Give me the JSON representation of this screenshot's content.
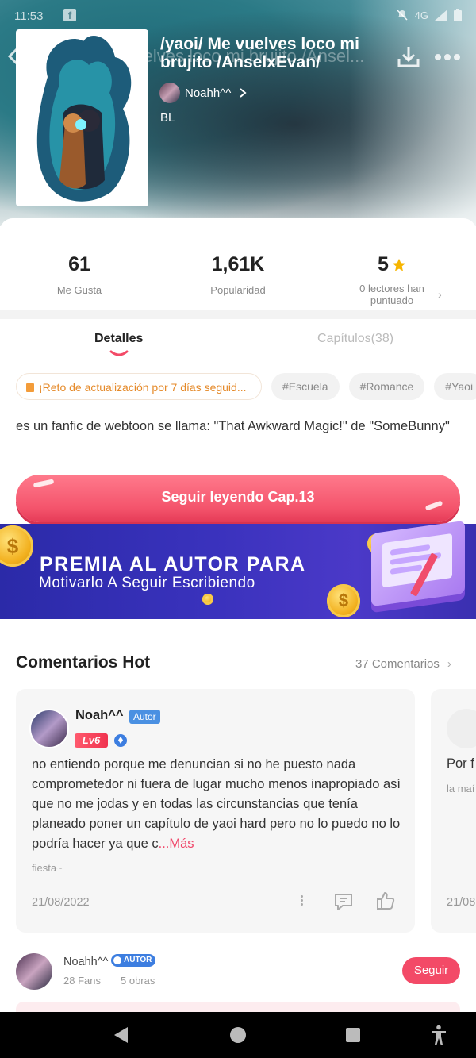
{
  "status_bar": {
    "time": "11:53",
    "network": "4G"
  },
  "header": {
    "ghost_title": "/yaoi/ Me vuelves loco mi brujito /Ansel...",
    "title": "/yaoi/ Me vuelves loco mi brujito /AnselxEvan/",
    "author": "Noahh^^",
    "genre": "BL"
  },
  "stats": {
    "likes_value": "61",
    "likes_label": "Me Gusta",
    "popularity_value": "1,61K",
    "popularity_label": "Popularidad",
    "rating_value": "5",
    "rating_label": "0 lectores han puntuado"
  },
  "tabs": {
    "details": "Detalles",
    "chapters": "Capítulos(38)"
  },
  "tags": [
    "¡Reto de actualización por 7 días seguid...",
    "#Escuela",
    "#Romance",
    "#Yaoi"
  ],
  "description": "es un fanfic de webtoon se llama: \"That Awkward Magic!\" de \"SomeBunny\"",
  "read_button": "Seguir leyendo Cap.13",
  "banner": {
    "line1": "PREMIA AL AUTOR PARA",
    "line2": "Motivarlo A Seguir Escribiendo",
    "coin_symbol": "$"
  },
  "comments": {
    "title": "Comentarios Hot",
    "count_link": "37 Comentarios",
    "items": [
      {
        "user": "Noah^^",
        "author_tag": "Autor",
        "level": "Lv6",
        "text": "no entiendo porque me denuncian si no he puesto nada comprometedor ni fuera de lugar mucho menos inapropiado así que no me jodas y en todas las circunstancias que tenía planeado poner un capítulo de yaoi hard pero no lo puedo no lo podría hacer ya que c",
        "more": "...Más",
        "sub": "fiesta~",
        "date": "21/08/2022"
      },
      {
        "text": "Por f",
        "sub": "la maí",
        "date": "21/08"
      }
    ]
  },
  "author_strip": {
    "name": "Noahh^^",
    "badge": "AUTOR",
    "fans": "28 Fans",
    "works": "5 obras",
    "follow": "Seguir"
  },
  "colors": {
    "accent": "#f34a67",
    "badge_blue": "#4a90e2",
    "banner_bg": "#3a32bd"
  }
}
